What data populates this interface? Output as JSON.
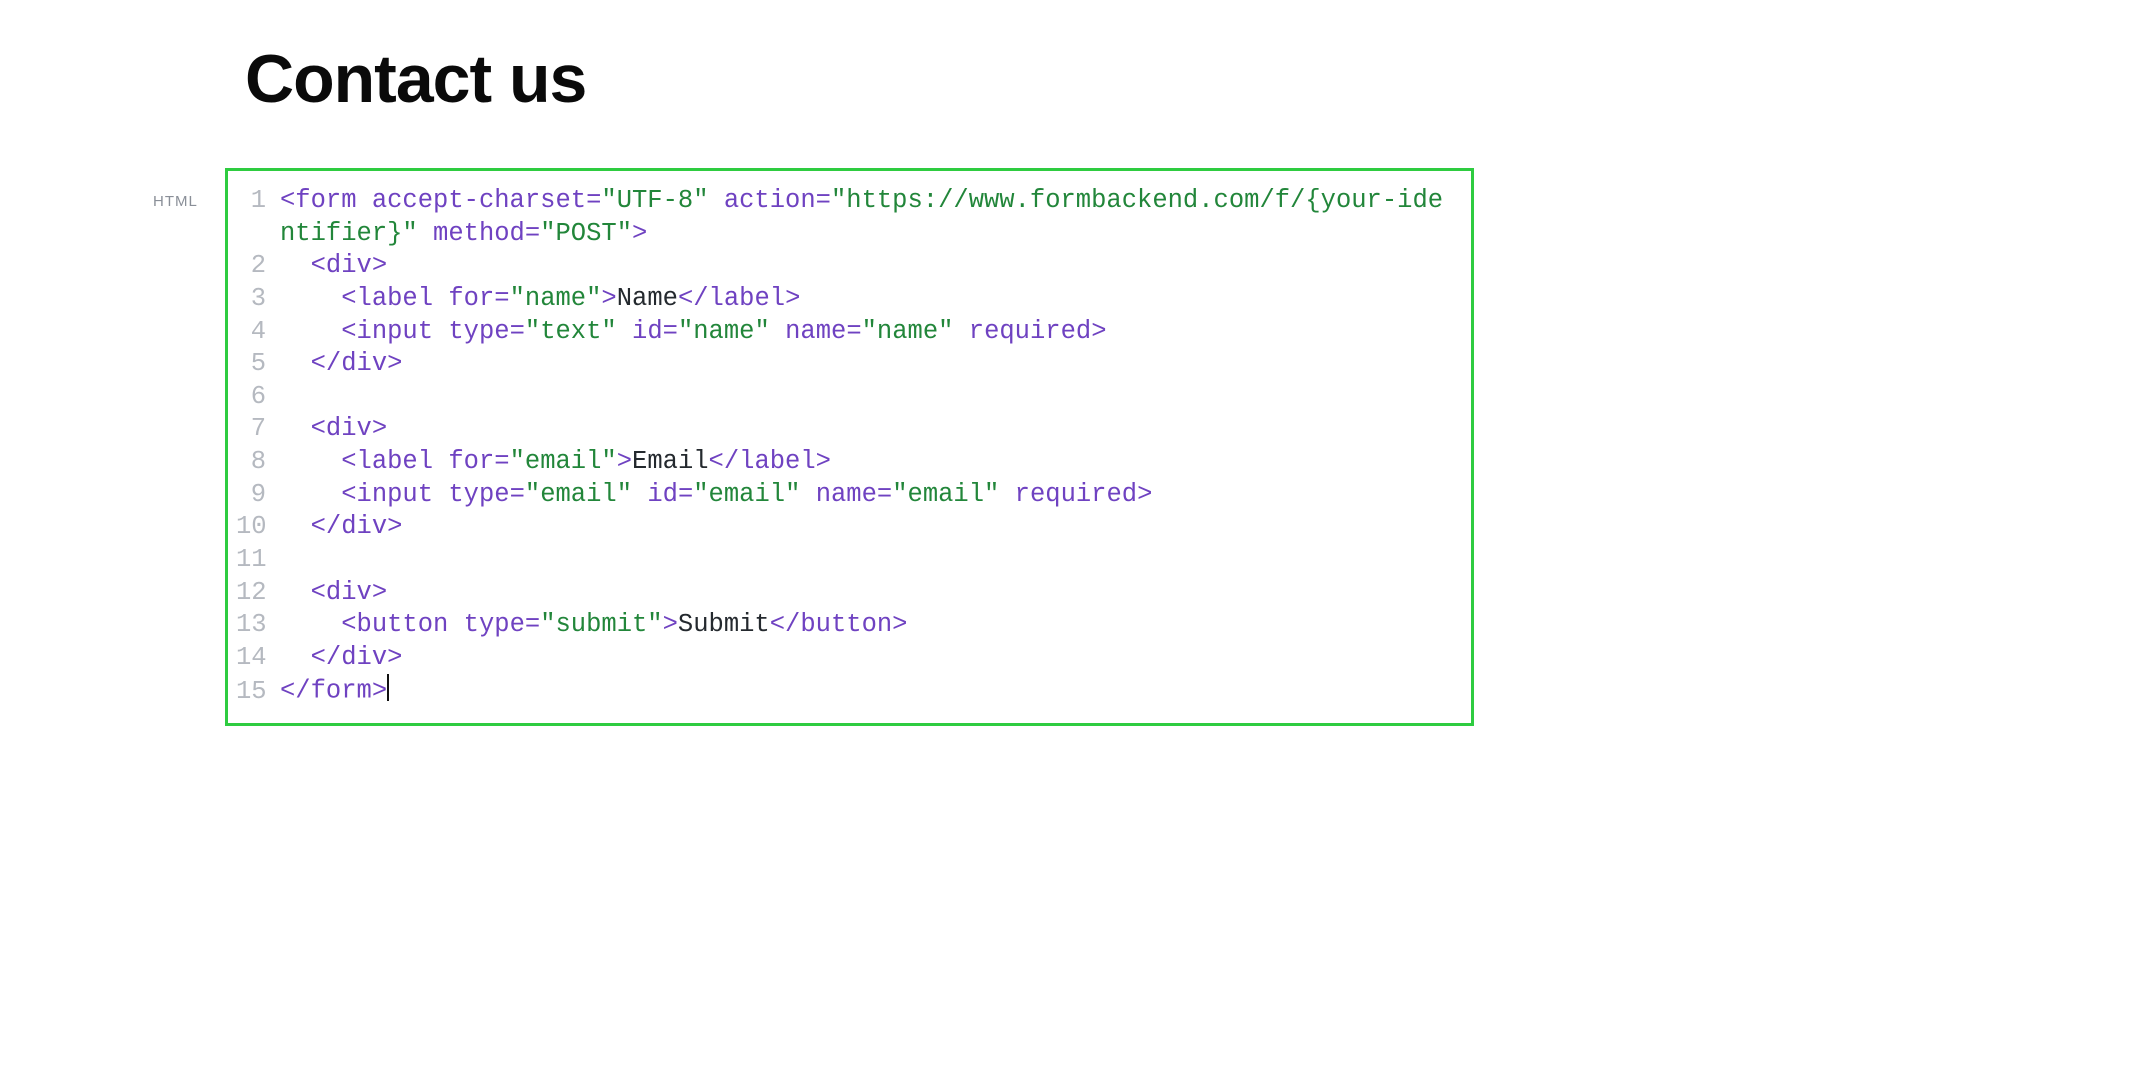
{
  "heading": "Contact us",
  "language_label": "HTML",
  "colors": {
    "border": "#2ecc40",
    "tag": "#6f42c1",
    "string": "#22863a",
    "text": "#24292e",
    "gutter": "#b5b9c0"
  },
  "code_lines": [
    {
      "n": 1,
      "tokens": [
        {
          "c": "p",
          "t": "<form"
        },
        {
          "c": "t",
          "t": " "
        },
        {
          "c": "p",
          "t": "accept-charset"
        },
        {
          "c": "p",
          "t": "="
        },
        {
          "c": "s",
          "t": "\"UTF-8\""
        },
        {
          "c": "t",
          "t": " "
        },
        {
          "c": "p",
          "t": "action"
        },
        {
          "c": "p",
          "t": "="
        },
        {
          "c": "s",
          "t": "\"https://www.formbackend.com/f/{your-identifier}\""
        },
        {
          "c": "t",
          "t": " "
        },
        {
          "c": "p",
          "t": "method"
        },
        {
          "c": "p",
          "t": "="
        },
        {
          "c": "s",
          "t": "\"POST\""
        },
        {
          "c": "p",
          "t": ">"
        }
      ]
    },
    {
      "n": 2,
      "indent": 1,
      "tokens": [
        {
          "c": "p",
          "t": "<div>"
        }
      ]
    },
    {
      "n": 3,
      "indent": 2,
      "tokens": [
        {
          "c": "p",
          "t": "<label"
        },
        {
          "c": "t",
          "t": " "
        },
        {
          "c": "p",
          "t": "for"
        },
        {
          "c": "p",
          "t": "="
        },
        {
          "c": "s",
          "t": "\"name\""
        },
        {
          "c": "p",
          "t": ">"
        },
        {
          "c": "t",
          "t": "Name"
        },
        {
          "c": "p",
          "t": "</label>"
        }
      ]
    },
    {
      "n": 4,
      "indent": 2,
      "tokens": [
        {
          "c": "p",
          "t": "<input"
        },
        {
          "c": "t",
          "t": " "
        },
        {
          "c": "p",
          "t": "type"
        },
        {
          "c": "p",
          "t": "="
        },
        {
          "c": "s",
          "t": "\"text\""
        },
        {
          "c": "t",
          "t": " "
        },
        {
          "c": "p",
          "t": "id"
        },
        {
          "c": "p",
          "t": "="
        },
        {
          "c": "s",
          "t": "\"name\""
        },
        {
          "c": "t",
          "t": " "
        },
        {
          "c": "p",
          "t": "name"
        },
        {
          "c": "p",
          "t": "="
        },
        {
          "c": "s",
          "t": "\"name\""
        },
        {
          "c": "t",
          "t": " "
        },
        {
          "c": "p",
          "t": "required"
        },
        {
          "c": "p",
          "t": ">"
        }
      ]
    },
    {
      "n": 5,
      "indent": 1,
      "tokens": [
        {
          "c": "p",
          "t": "</div>"
        }
      ]
    },
    {
      "n": 6,
      "indent": 0,
      "tokens": []
    },
    {
      "n": 7,
      "indent": 1,
      "tokens": [
        {
          "c": "p",
          "t": "<div>"
        }
      ]
    },
    {
      "n": 8,
      "indent": 2,
      "tokens": [
        {
          "c": "p",
          "t": "<label"
        },
        {
          "c": "t",
          "t": " "
        },
        {
          "c": "p",
          "t": "for"
        },
        {
          "c": "p",
          "t": "="
        },
        {
          "c": "s",
          "t": "\"email\""
        },
        {
          "c": "p",
          "t": ">"
        },
        {
          "c": "t",
          "t": "Email"
        },
        {
          "c": "p",
          "t": "</label>"
        }
      ]
    },
    {
      "n": 9,
      "indent": 2,
      "tokens": [
        {
          "c": "p",
          "t": "<input"
        },
        {
          "c": "t",
          "t": " "
        },
        {
          "c": "p",
          "t": "type"
        },
        {
          "c": "p",
          "t": "="
        },
        {
          "c": "s",
          "t": "\"email\""
        },
        {
          "c": "t",
          "t": " "
        },
        {
          "c": "p",
          "t": "id"
        },
        {
          "c": "p",
          "t": "="
        },
        {
          "c": "s",
          "t": "\"email\""
        },
        {
          "c": "t",
          "t": " "
        },
        {
          "c": "p",
          "t": "name"
        },
        {
          "c": "p",
          "t": "="
        },
        {
          "c": "s",
          "t": "\"email\""
        },
        {
          "c": "t",
          "t": " "
        },
        {
          "c": "p",
          "t": "required"
        },
        {
          "c": "p",
          "t": ">"
        }
      ]
    },
    {
      "n": 10,
      "indent": 1,
      "tokens": [
        {
          "c": "p",
          "t": "</div>"
        }
      ]
    },
    {
      "n": 11,
      "indent": 0,
      "tokens": []
    },
    {
      "n": 12,
      "indent": 1,
      "tokens": [
        {
          "c": "p",
          "t": "<div>"
        }
      ]
    },
    {
      "n": 13,
      "indent": 2,
      "tokens": [
        {
          "c": "p",
          "t": "<button"
        },
        {
          "c": "t",
          "t": " "
        },
        {
          "c": "p",
          "t": "type"
        },
        {
          "c": "p",
          "t": "="
        },
        {
          "c": "s",
          "t": "\"submit\""
        },
        {
          "c": "p",
          "t": ">"
        },
        {
          "c": "t",
          "t": "Submit"
        },
        {
          "c": "p",
          "t": "</button>"
        }
      ]
    },
    {
      "n": 14,
      "indent": 1,
      "tokens": [
        {
          "c": "p",
          "t": "</div>"
        }
      ]
    },
    {
      "n": 15,
      "indent": 0,
      "cursor_after": true,
      "tokens": [
        {
          "c": "p",
          "t": "</form>"
        }
      ]
    }
  ]
}
